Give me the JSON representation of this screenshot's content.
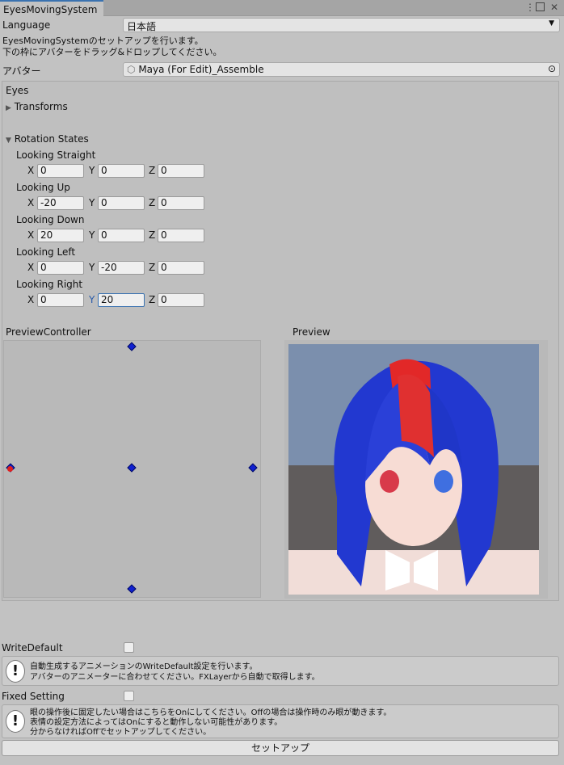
{
  "window": {
    "tab_title": "EyesMovingSystem"
  },
  "language": {
    "label": "Language",
    "value": "日本語"
  },
  "intro": [
    "EyesMovingSystemのセットアップを行います。",
    "下の枠にアバターをドラッグ&ドロップしてください。"
  ],
  "avatar": {
    "label": "アバター",
    "value": "Maya (For Edit)_Assemble"
  },
  "eyes": {
    "title": "Eyes",
    "transforms": "Transforms",
    "rotation_states": "Rotation States",
    "states": [
      {
        "label": "Looking Straight",
        "x": "0",
        "y": "0",
        "z": "0"
      },
      {
        "label": "Looking Up",
        "x": "-20",
        "y": "0",
        "z": "0"
      },
      {
        "label": "Looking Down",
        "x": "20",
        "y": "0",
        "z": "0"
      },
      {
        "label": "Looking Left",
        "x": "0",
        "y": "-20",
        "z": "0"
      },
      {
        "label": "Looking Right",
        "x": "0",
        "y": "20",
        "z": "0"
      }
    ],
    "axes": {
      "x": "X",
      "y": "Y",
      "z": "Z"
    }
  },
  "preview_controller": {
    "label": "PreviewController"
  },
  "preview": {
    "label": "Preview"
  },
  "write_default": {
    "label": "WriteDefault",
    "checked": false,
    "help": [
      "自動生成するアニメーションのWriteDefault設定を行います。",
      "アバターのアニメーターに合わせてください。FXLayerから自動で取得します。"
    ]
  },
  "fixed_setting": {
    "label": "Fixed Setting",
    "checked": false,
    "help": [
      "眼の操作後に固定したい場合はこちらをOnにしてください。Offの場合は操作時のみ眼が動きます。",
      "表情の設定方法によってはOnにすると動作しない可能性があります。",
      "分からなければOffでセットアップしてください。"
    ]
  },
  "setup_button": "セットアップ"
}
